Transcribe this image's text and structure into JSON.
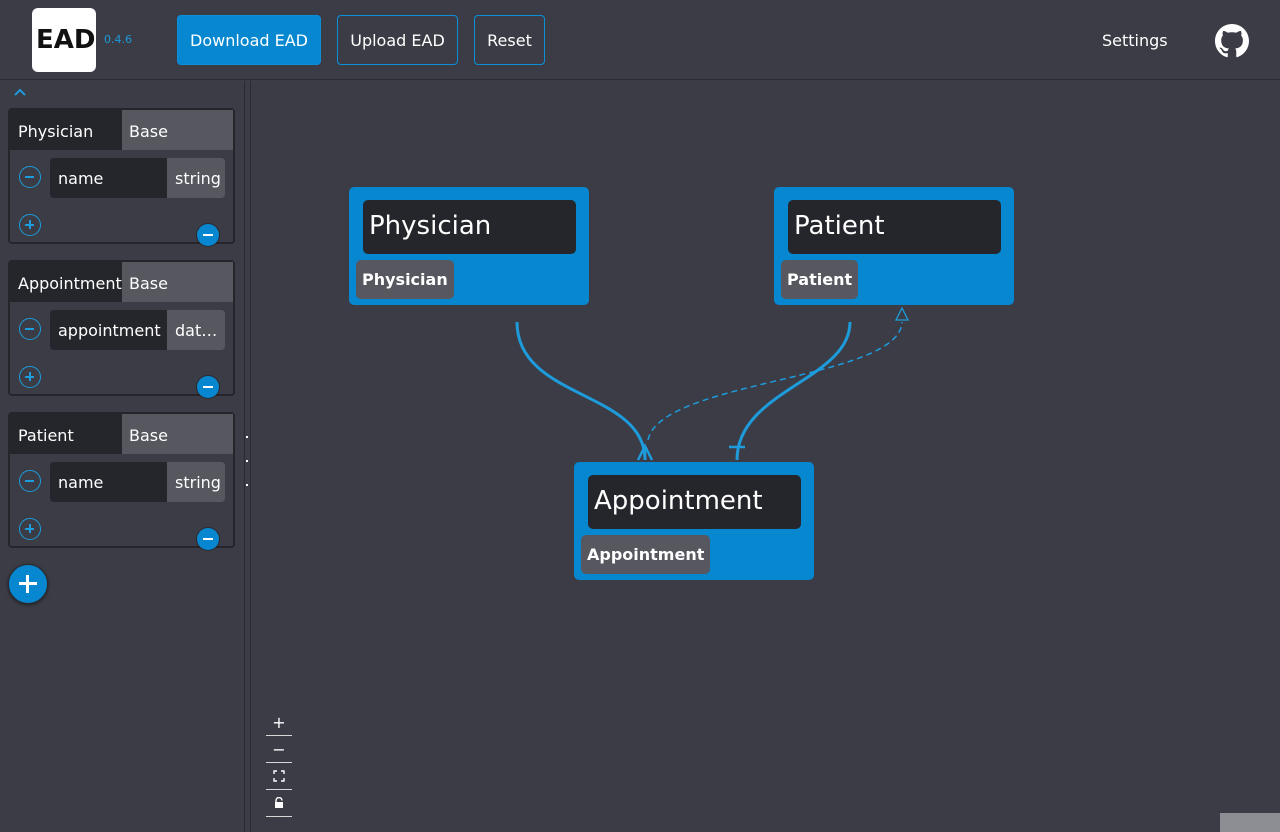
{
  "header": {
    "logo_text": "EAD",
    "version": "0.4.6",
    "download_label": "Download EAD",
    "upload_label": "Upload EAD",
    "reset_label": "Reset",
    "settings_label": "Settings",
    "github_icon": "github-icon"
  },
  "colors": {
    "accent": "#0787cf",
    "edge": "#1d9bdb",
    "background": "#3b3c45",
    "dark_field": "#25262b",
    "mid_field": "#56575f"
  },
  "sidebar": {
    "entities": [
      {
        "name": "Physician",
        "base": "Base",
        "attribute_name": "name",
        "attribute_type": "string"
      },
      {
        "name": "Appointment",
        "base": "Base",
        "attribute_name": "appointment",
        "attribute_type": "datetime"
      },
      {
        "name": "Patient",
        "base": "Base",
        "attribute_name": "name",
        "attribute_type": "string"
      }
    ]
  },
  "canvas": {
    "nodes": [
      {
        "title": "Physician",
        "tag": "Physician"
      },
      {
        "title": "Patient",
        "tag": "Patient"
      },
      {
        "title": "Appointment",
        "tag": "Appointment"
      }
    ],
    "controls": {
      "zoom_in": "+",
      "zoom_out": "−",
      "fit_view": "⛶",
      "lock": "🔒"
    }
  }
}
